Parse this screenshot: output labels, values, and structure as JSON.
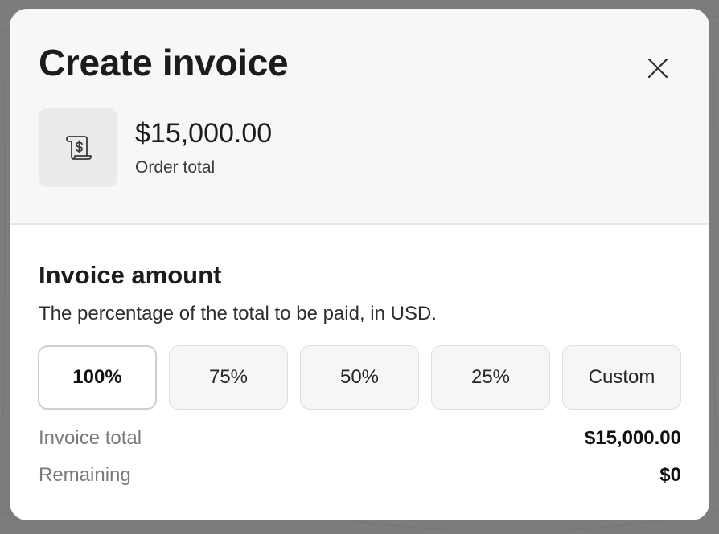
{
  "modal": {
    "title": "Create invoice",
    "close_icon": "close-icon",
    "order": {
      "icon": "invoice-scroll-dollar-icon",
      "amount": "$15,000.00",
      "label": "Order total"
    }
  },
  "invoice_amount": {
    "title": "Invoice amount",
    "description": "The percentage of the total to be paid, in USD.",
    "options": [
      {
        "label": "100%",
        "selected": true
      },
      {
        "label": "75%",
        "selected": false
      },
      {
        "label": "50%",
        "selected": false
      },
      {
        "label": "25%",
        "selected": false
      },
      {
        "label": "Custom",
        "selected": false
      }
    ],
    "selected_percent": 100
  },
  "summary": {
    "invoice_total_label": "Invoice total",
    "invoice_total_value": "$15,000.00",
    "remaining_label": "Remaining",
    "remaining_value": "$0"
  },
  "colors": {
    "backdrop": "#7c7c7a",
    "header_bg": "#f7f7f7",
    "modal_bg": "#ffffff",
    "option_bg": "#f6f6f6",
    "muted_text": "#7a7a7a"
  }
}
